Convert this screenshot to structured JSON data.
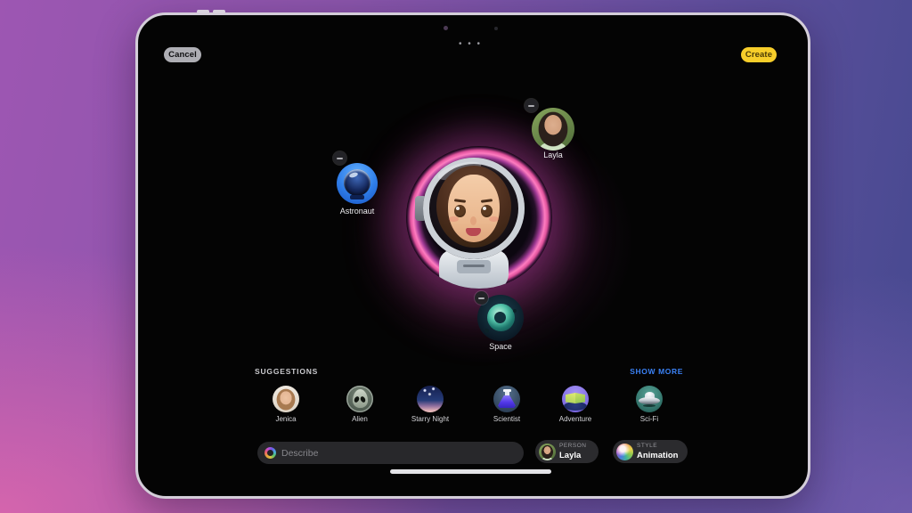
{
  "nav": {
    "cancel": "Cancel",
    "create": "Create",
    "more": "• • •"
  },
  "canvas": {
    "attachments": [
      {
        "label": "Astronaut",
        "icon": "astronaut-helmet-icon",
        "removable": true
      },
      {
        "label": "Layla",
        "icon": "person-photo-thumb",
        "removable": true
      },
      {
        "label": "Space",
        "icon": "planet-icon",
        "removable": true
      }
    ],
    "preview": "generated-astronaut-portrait"
  },
  "suggestions": {
    "header": "SUGGESTIONS",
    "show_more": "SHOW MORE",
    "items": [
      {
        "label": "Jenica",
        "icon": "person-photo-jenica"
      },
      {
        "label": "Alien",
        "icon": "alien-head-icon"
      },
      {
        "label": "Starry Night",
        "icon": "night-sky-icon"
      },
      {
        "label": "Scientist",
        "icon": "flask-icon"
      },
      {
        "label": "Adventure",
        "icon": "open-map-icon"
      },
      {
        "label": "Sci-Fi",
        "icon": "ufo-icon"
      }
    ]
  },
  "composer": {
    "prompt_placeholder": "Describe",
    "prompt_icon": "apple-intelligence-icon",
    "person": {
      "category": "PERSON",
      "value": "Layla",
      "icon": "person-photo-thumb"
    },
    "style": {
      "category": "STYLE",
      "value": "Animation",
      "icon": "style-swirl-icon"
    }
  },
  "colors": {
    "create_accent": "#f7ce2a",
    "link_blue": "#3b82f7",
    "glow_pink": "#ff7cc0",
    "screen_bg": "#040404"
  }
}
